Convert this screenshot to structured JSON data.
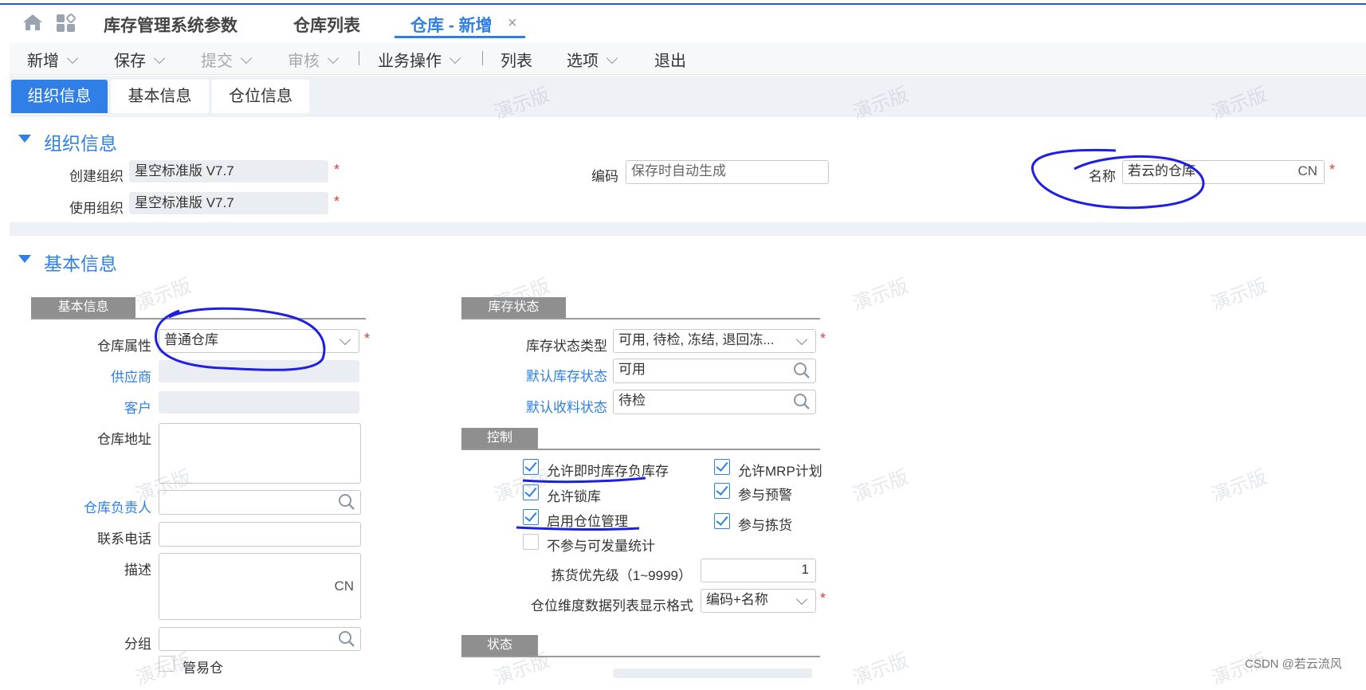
{
  "tabs": {
    "home_icon": "home-icon",
    "apps_icon": "apps-icon",
    "items": [
      {
        "label": "库存管理系统参数"
      },
      {
        "label": "仓库列表"
      },
      {
        "label": "仓库 - 新增"
      }
    ],
    "close_symbol": "×"
  },
  "toolbar": {
    "new": "新增",
    "save": "保存",
    "submit": "提交",
    "audit": "审核",
    "business": "业务操作",
    "list": "列表",
    "options": "选项",
    "exit": "退出"
  },
  "subtabs": [
    {
      "label": "组织信息"
    },
    {
      "label": "基本信息"
    },
    {
      "label": "仓位信息"
    }
  ],
  "org": {
    "title": "组织信息",
    "create_org_label": "创建组织",
    "create_org_value": "星空标准版 V7.7",
    "use_org_label": "使用组织",
    "use_org_value": "星空标准版 V7.7",
    "code_label": "编码",
    "code_placeholder": "保存时自动生成",
    "name_label": "名称",
    "name_value": "若云的仓库",
    "name_lang": "CN"
  },
  "basic": {
    "title": "基本信息",
    "group_basic": "基本信息",
    "warehouse_attr_label": "仓库属性",
    "warehouse_attr_value": "普通仓库",
    "supplier_label": "供应商",
    "customer_label": "客户",
    "address_label": "仓库地址",
    "manager_label": "仓库负责人",
    "phone_label": "联系电话",
    "desc_label": "描述",
    "desc_lang": "CN",
    "group_label": "分组",
    "simple_wh_label": "管易仓"
  },
  "stock": {
    "group_title": "库存状态",
    "status_type_label": "库存状态类型",
    "status_type_value": "可用, 待检, 冻结, 退回冻...",
    "default_stock_label": "默认库存状态",
    "default_stock_value": "可用",
    "default_receive_label": "默认收料状态",
    "default_receive_value": "待检"
  },
  "control": {
    "group_title": "控制",
    "items": [
      {
        "label": "允许即时库存负库存",
        "checked": true
      },
      {
        "label": "允许MRP计划",
        "checked": true
      },
      {
        "label": "允许锁库",
        "checked": true
      },
      {
        "label": "参与预警",
        "checked": true
      },
      {
        "label": "启用仓位管理",
        "checked": true
      },
      {
        "label": "参与拣货",
        "checked": true
      },
      {
        "label": "不参与可发量统计",
        "checked": false
      }
    ],
    "pick_priority_label": "拣货优先级（1~9999）",
    "pick_priority_value": "1",
    "loc_format_label": "仓位维度数据列表显示格式",
    "loc_format_value": "编码+名称"
  },
  "status": {
    "group_title": "状态"
  },
  "watermark": "演示版",
  "credit": "CSDN @若云流风",
  "colors": {
    "accent": "#2f7fe6",
    "required": "#e23b3b",
    "annotation": "#1e1ee6"
  }
}
